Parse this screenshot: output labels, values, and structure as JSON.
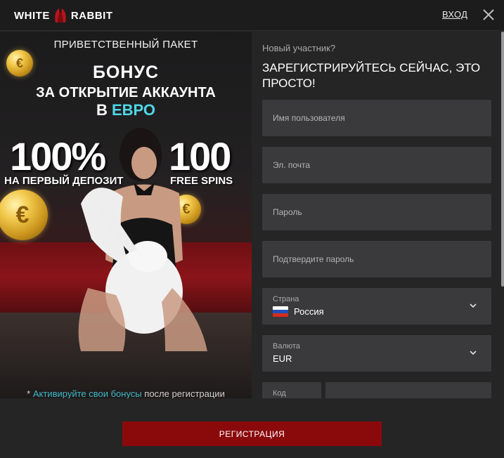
{
  "header": {
    "logo_left": "WHITE",
    "logo_right": "RABBIT",
    "login_label": "ВХОД"
  },
  "promo": {
    "title": "ПРИВЕТСТВЕННЫЙ ПАКЕТ",
    "bonus": "БОНУС",
    "account_line": "ЗА ОТКРЫТИЕ АККАУНТА",
    "currency_prefix": "В",
    "currency": "ЕВРО",
    "percent": "100%",
    "percent_sub": "НА ПЕРВЫЙ ДЕПОЗИТ",
    "spins": "100",
    "spins_sub": "FREE SPINS",
    "coin_symbol": "€",
    "footnote_prefix": "*",
    "footnote_link": "Активируйте свои бонусы",
    "footnote_rest": "после регистрации"
  },
  "form": {
    "subtitle": "Новый участник?",
    "heading": "ЗАРЕГИСТРИРУЙТЕСЬ СЕЙЧАС, ЭТО ПРОСТО!",
    "username_placeholder": "Имя пользователя",
    "email_placeholder": "Эл. почта",
    "password_placeholder": "Пароль",
    "confirm_placeholder": "Подтвердите пароль",
    "country_label": "Страна",
    "country_value": "Россия",
    "currency_label": "Валюта",
    "currency_value": "EUR",
    "code_label": "Код"
  },
  "footer": {
    "register_label": "РЕГИСТРАЦИЯ"
  },
  "colors": {
    "accent_red": "#8a0a0c",
    "accent_cyan": "#4fd7e8",
    "field_bg": "#3a3a3c"
  },
  "icons": [
    "rabbit-logo-icon",
    "close-icon",
    "coin-icon",
    "chevron-down-icon",
    "flag-russia-icon"
  ]
}
